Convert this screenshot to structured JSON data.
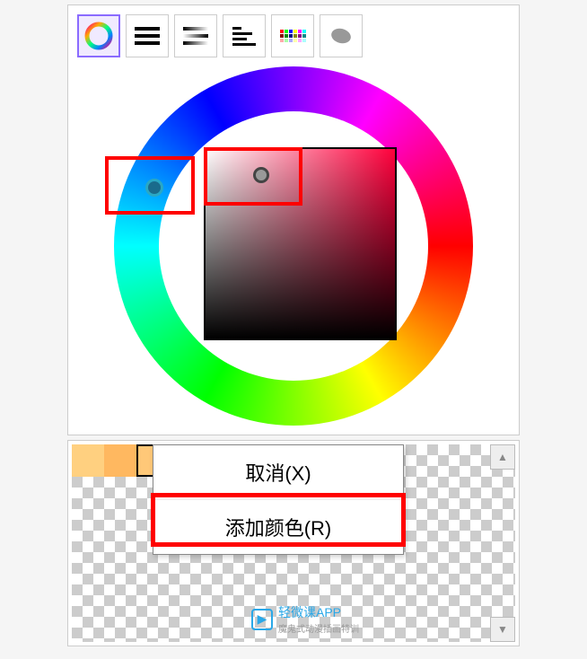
{
  "toolbar": {
    "tabs": [
      {
        "name": "color-wheel",
        "selected": true
      },
      {
        "name": "lines",
        "selected": false
      },
      {
        "name": "gradient",
        "selected": false
      },
      {
        "name": "list",
        "selected": false
      },
      {
        "name": "palette",
        "selected": false
      },
      {
        "name": "blob",
        "selected": false
      }
    ]
  },
  "color_picker": {
    "hue_marker_color": "#1a8bb0",
    "sv_marker_color": "#888888",
    "selected_hue": "#ff003c"
  },
  "swatches": {
    "colors": [
      "#ffd080",
      "#ffb860",
      "#ffc878"
    ],
    "active_index": 2
  },
  "context_menu": {
    "items": [
      {
        "label": "取消(X)",
        "action": "cancel"
      },
      {
        "label": "添加颜色(R)",
        "action": "add-color"
      }
    ]
  },
  "highlights": {
    "hue_box": true,
    "sv_box": true,
    "menu_box": true
  },
  "watermark": {
    "title": "轻微课APP",
    "subtitle": "魔鬼式动漫插画特训"
  },
  "palette_grid_colors": [
    "#f00",
    "#0f0",
    "#00f",
    "#ff0",
    "#f0f",
    "#0ff",
    "#800",
    "#080",
    "#008",
    "#880",
    "#808",
    "#088",
    "#faa",
    "#afa",
    "#aaf",
    "#ffa",
    "#faf",
    "#aff"
  ]
}
